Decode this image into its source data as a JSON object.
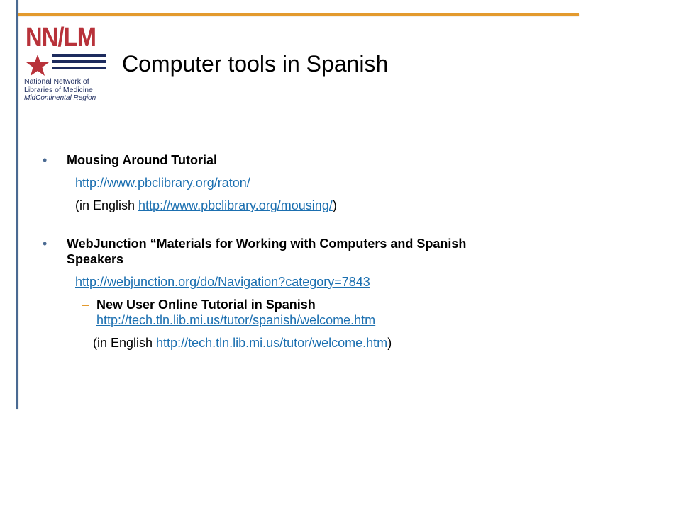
{
  "logo": {
    "mark": "NN/LM",
    "line1": "National Network of",
    "line2": "Libraries of Medicine",
    "line3": "MidContinental Region",
    "star_icon": "star-icon",
    "red": "#b8323a",
    "navy": "#1d2b5e"
  },
  "slide": {
    "title": "Computer tools in Spanish"
  },
  "bullets": [
    {
      "heading": "Mousing Around Tutorial",
      "url": "http://www.pbclibrary.org/raton/",
      "english_prefix": "(in English ",
      "english_url": "http://www.pbclibrary.org/mousing/",
      "english_suffix": ")"
    },
    {
      "heading_line1": "WebJunction “Materials for Working with Computers and Spanish",
      "heading_line2": "Speakers",
      "url": "http://webjunction.org/do/Navigation?category=7843",
      "sub": {
        "dash": "–",
        "heading": "New User Online Tutorial in Spanish",
        "url": "http://tech.tln.lib.mi.us/tutor/spanish/welcome.htm",
        "english_prefix": "(in English ",
        "english_url": "http://tech.tln.lib.mi.us/tutor/welcome.htm",
        "english_suffix": ")"
      }
    }
  ],
  "colors": {
    "accent_orange": "#e39a2e",
    "rule_blue": "#4a6a92",
    "link": "#1b6fb0"
  }
}
